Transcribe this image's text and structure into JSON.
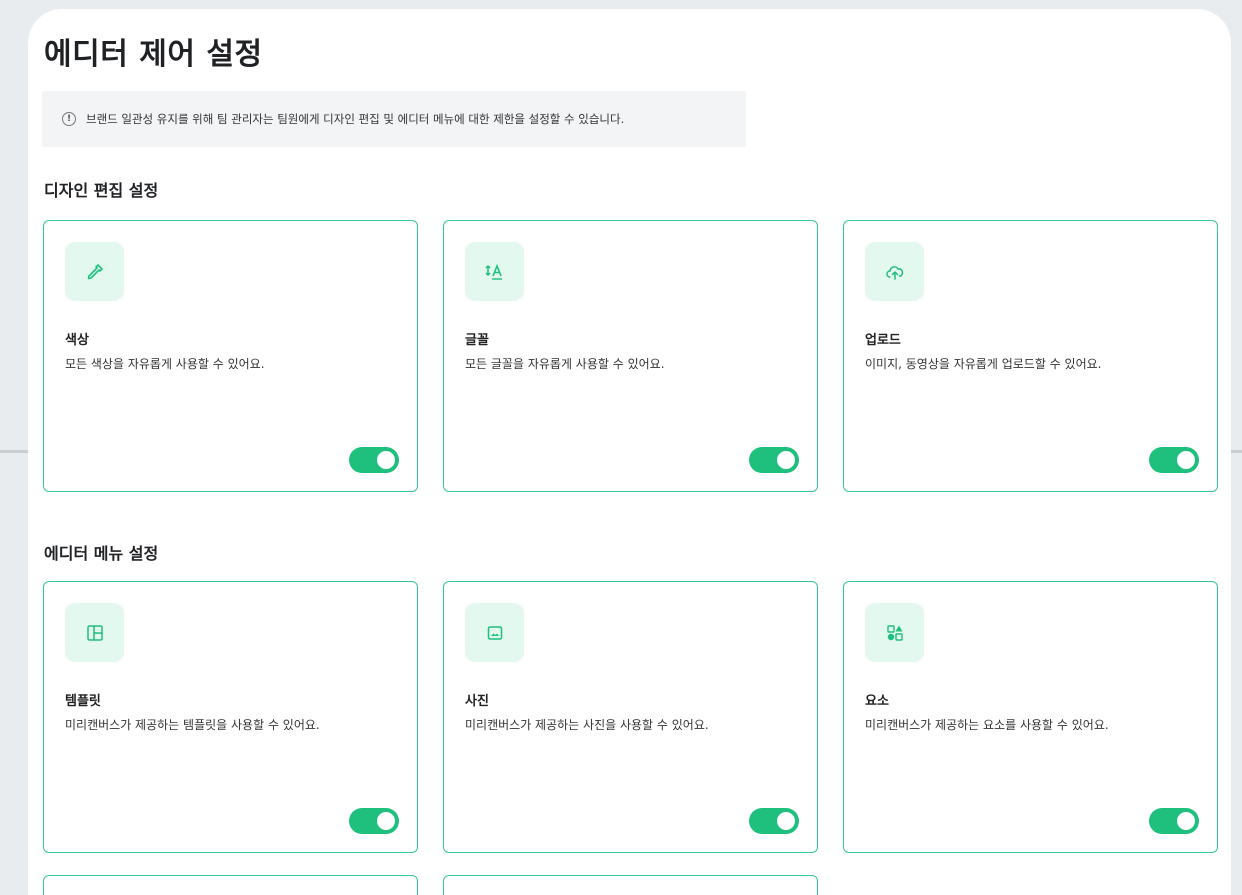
{
  "page": {
    "title": "에디터 제어 설정",
    "notice": "브랜드 일관성 유지를 위해 팀 관리자는 팀원에게 디자인 편집 및 에디터 메뉴에 대한 제한을 설정할 수 있습니다.",
    "notice_icon": "info-icon"
  },
  "design_section": {
    "title": "디자인 편집 설정",
    "cards": [
      {
        "icon": "eyedropper-icon",
        "title": "색상",
        "desc": "모든 색상을 자유롭게 사용할 수 있어요.",
        "enabled": true
      },
      {
        "icon": "text-size-icon",
        "title": "글꼴",
        "desc": "모든 글꼴을 자유롭게 사용할 수 있어요.",
        "enabled": true
      },
      {
        "icon": "cloud-upload-icon",
        "title": "업로드",
        "desc": "이미지, 동영상을 자유롭게 업로드할 수 있어요.",
        "enabled": true
      }
    ]
  },
  "menu_section": {
    "title": "에디터 메뉴 설정",
    "cards": [
      {
        "icon": "template-layout-icon",
        "title": "템플릿",
        "desc": "미리캔버스가 제공하는 템플릿을 사용할 수 있어요.",
        "enabled": true
      },
      {
        "icon": "image-icon",
        "title": "사진",
        "desc": "미리캔버스가 제공하는 사진을 사용할 수 있어요.",
        "enabled": true
      },
      {
        "icon": "shapes-icon",
        "title": "요소",
        "desc": "미리캔버스가 제공하는 요소를 사용할 수 있어요.",
        "enabled": true
      }
    ]
  },
  "colors": {
    "accent": "#1fbf7e",
    "card_border": "#34c991",
    "icon_bg": "#e3f8ee",
    "icon_fg": "#1fbf7e"
  }
}
